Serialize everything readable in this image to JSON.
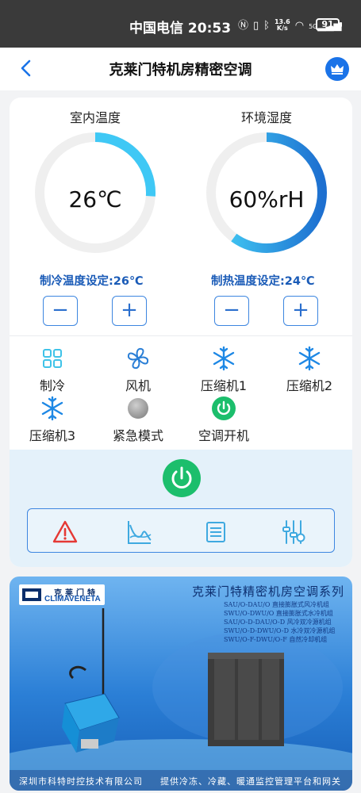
{
  "status_bar": {
    "carrier_time": "中国电信 20:53",
    "net_speed_top": "13.6",
    "net_speed_bottom": "K/s",
    "signal_label": "5G",
    "battery": "91"
  },
  "header": {
    "title": "克莱门特机房精密空调"
  },
  "gauges": [
    {
      "label": "室内温度",
      "value": "26℃",
      "level": 0.26,
      "arc_color": "#3fc8f5"
    },
    {
      "label": "环境湿度",
      "value": "60%rH",
      "level": 0.6,
      "arc_color": "#3fc8f5"
    }
  ],
  "setpoints": {
    "cooling": "制冷温度设定:26℃",
    "heating": "制热温度设定:24℃",
    "minus": "−",
    "plus": "+"
  },
  "status_items": [
    {
      "label": "制冷",
      "icon": "grid-icon"
    },
    {
      "label": "风机",
      "icon": "fan-icon"
    },
    {
      "label": "压缩机1",
      "icon": "snowflake-icon"
    },
    {
      "label": "压缩机2",
      "icon": "snowflake-icon"
    },
    {
      "label": "压缩机3",
      "icon": "snowflake-icon"
    },
    {
      "label": "紧急模式",
      "icon": "grey-dot-icon"
    },
    {
      "label": "空调开机",
      "icon": "power-on-icon"
    }
  ],
  "toolbar": [
    "alarm-icon",
    "chart-icon",
    "list-icon",
    "settings-sliders-icon"
  ],
  "banner": {
    "logo_cn": "克莱门特",
    "logo_en": "CLIMAVENETA",
    "title": "克莱门特精密机房空调系列",
    "models": [
      "SAU/O-DAU/O 直接膨胀式风冷机组",
      "SWU/O-DWU/O 直接膨胀式水冷机组",
      "SAU/O-D-DAU/O-D 风冷双冷源机组",
      "SWU/O-D-DWU/O-D 水冷双冷源机组",
      "SWU/O-F-DWU/O-F 自然冷却机组"
    ],
    "footer_left": "深圳市科特时控技术有限公司",
    "footer_right": "提供冷冻、冷藏、暖通监控管理平台和网关"
  },
  "colors": {
    "accent": "#1a73e8",
    "setpoint_text": "#1a5bb7",
    "power_green": "#1cbe6c",
    "alarm_red": "#e53935",
    "panel_bg": "#e4f1fa"
  }
}
